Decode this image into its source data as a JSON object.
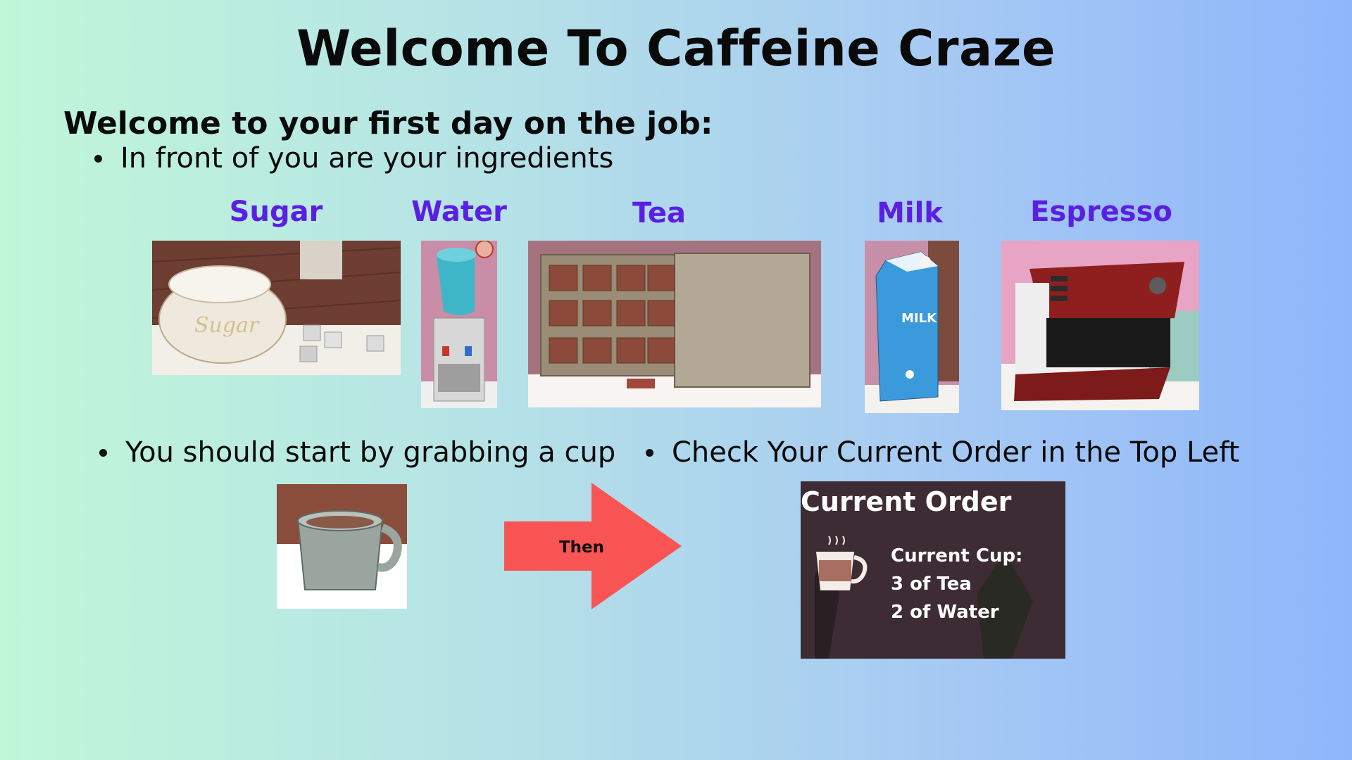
{
  "title": "Welcome To Caffeine Craze",
  "subtitle": "Welcome to your first day on the job:",
  "bullets": {
    "ingredients": "In front of you are your ingredients",
    "cup": "You should start by grabbing a cup",
    "order": "Check Your Current Order in the Top Left"
  },
  "ingredients": [
    {
      "label": "Sugar",
      "icon": "sugar-bowl-icon"
    },
    {
      "label": "Water",
      "icon": "water-cooler-icon"
    },
    {
      "label": "Tea",
      "icon": "tea-box-icon"
    },
    {
      "label": "Milk",
      "icon": "milk-carton-icon"
    },
    {
      "label": "Espresso",
      "icon": "espresso-machine-icon"
    }
  ],
  "arrow": {
    "label": "Then",
    "color": "#f95454",
    "icon": "right-arrow-icon"
  },
  "current_order": {
    "heading": "Current Order",
    "cup_label": "Current Cup:",
    "line1": "3 of Tea",
    "line2": "2 of Water",
    "icon": "coffee-cup-icon"
  },
  "sugar_text": "Sugar",
  "milk_text": "MILK",
  "colors": {
    "label": "#5b1fe3",
    "arrow": "#f95454",
    "panel": "#3d2c33"
  }
}
